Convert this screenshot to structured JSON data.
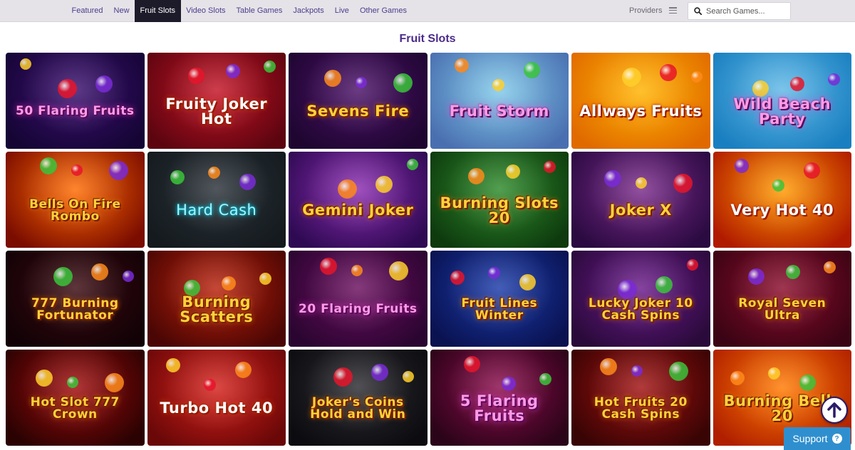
{
  "nav": {
    "items": [
      {
        "label": "Featured",
        "active": false
      },
      {
        "label": "New",
        "active": false
      },
      {
        "label": "Fruit Slots",
        "active": true
      },
      {
        "label": "Video Slots",
        "active": false
      },
      {
        "label": "Table Games",
        "active": false
      },
      {
        "label": "Jackpots",
        "active": false
      },
      {
        "label": "Live",
        "active": false
      },
      {
        "label": "Other Games",
        "active": false
      }
    ],
    "providers_label": "Providers",
    "search_placeholder": "Search Games..."
  },
  "section": {
    "title": "Fruit Slots"
  },
  "games": [
    {
      "title": "50 Flaring Fruits",
      "bg": [
        "#3a0f6e",
        "#150535"
      ],
      "style": "pink"
    },
    {
      "title": "Fruity Joker Hot",
      "bg": [
        "#c41224",
        "#5c0510"
      ],
      "style": "white"
    },
    {
      "title": "Sevens Fire",
      "bg": [
        "#4a1066",
        "#1e0630"
      ],
      "style": ""
    },
    {
      "title": "Fruit Storm",
      "bg": [
        "#7fc8e8",
        "#4a6fb0"
      ],
      "style": "pink"
    },
    {
      "title": "Allways Fruits",
      "bg": [
        "#ffb300",
        "#e06a00"
      ],
      "style": "white"
    },
    {
      "title": "Wild Beach Party",
      "bg": [
        "#5fb8e6",
        "#1a7fc0"
      ],
      "style": "pink"
    },
    {
      "title": "Bells On Fire Rombo",
      "bg": [
        "#ff6a00",
        "#7a0c00"
      ],
      "style": ""
    },
    {
      "title": "Hard Cash",
      "bg": [
        "#2a3238",
        "#141a1e"
      ],
      "style": "cyan"
    },
    {
      "title": "Gemini Joker",
      "bg": [
        "#8a2bb0",
        "#2e0a52"
      ],
      "style": ""
    },
    {
      "title": "Burning Slots 20",
      "bg": [
        "#2d8a2a",
        "#0e3a0e"
      ],
      "style": ""
    },
    {
      "title": "Joker X",
      "bg": [
        "#7a2a8a",
        "#2a0a40"
      ],
      "style": ""
    },
    {
      "title": "Very Hot 40",
      "bg": [
        "#ff9a00",
        "#b01a00"
      ],
      "style": "white"
    },
    {
      "title": "777 Burning Fortunator",
      "bg": [
        "#3a0a10",
        "#120206"
      ],
      "style": ""
    },
    {
      "title": "Burning Scatters",
      "bg": [
        "#b8200a",
        "#4a0604"
      ],
      "style": ""
    },
    {
      "title": "20 Flaring Fruits",
      "bg": [
        "#6a0e5e",
        "#2a0530"
      ],
      "style": "pink"
    },
    {
      "title": "Fruit Lines Winter",
      "bg": [
        "#1a3aa8",
        "#0a1250"
      ],
      "style": ""
    },
    {
      "title": "Lucky Joker 10 Cash Spins",
      "bg": [
        "#6a1a8a",
        "#2a0a3a"
      ],
      "style": ""
    },
    {
      "title": "Royal Seven Ultra",
      "bg": [
        "#8a0a2a",
        "#3a0414"
      ],
      "style": ""
    },
    {
      "title": "Hot Slot 777 Crown",
      "bg": [
        "#a00a0a",
        "#2a0202"
      ],
      "style": ""
    },
    {
      "title": "Turbo Hot 40",
      "bg": [
        "#d4201a",
        "#6a0808"
      ],
      "style": "white"
    },
    {
      "title": "Joker's Coins Hold and Win",
      "bg": [
        "#2a2a30",
        "#0c0c10"
      ],
      "style": ""
    },
    {
      "title": "5 Flaring Fruits",
      "bg": [
        "#8a0a4a",
        "#2a0418"
      ],
      "style": "pink"
    },
    {
      "title": "Hot Fruits 20 Cash Spins",
      "bg": [
        "#a01010",
        "#380404"
      ],
      "style": ""
    },
    {
      "title": "Burning Bells 20",
      "bg": [
        "#ff7a00",
        "#b02000"
      ],
      "style": ""
    }
  ],
  "support": {
    "label": "Support",
    "icon": "question-icon"
  },
  "colors": {
    "accent": "#4b2b8a",
    "nav_active": "#1d1b2a",
    "support": "#2f8fce"
  }
}
